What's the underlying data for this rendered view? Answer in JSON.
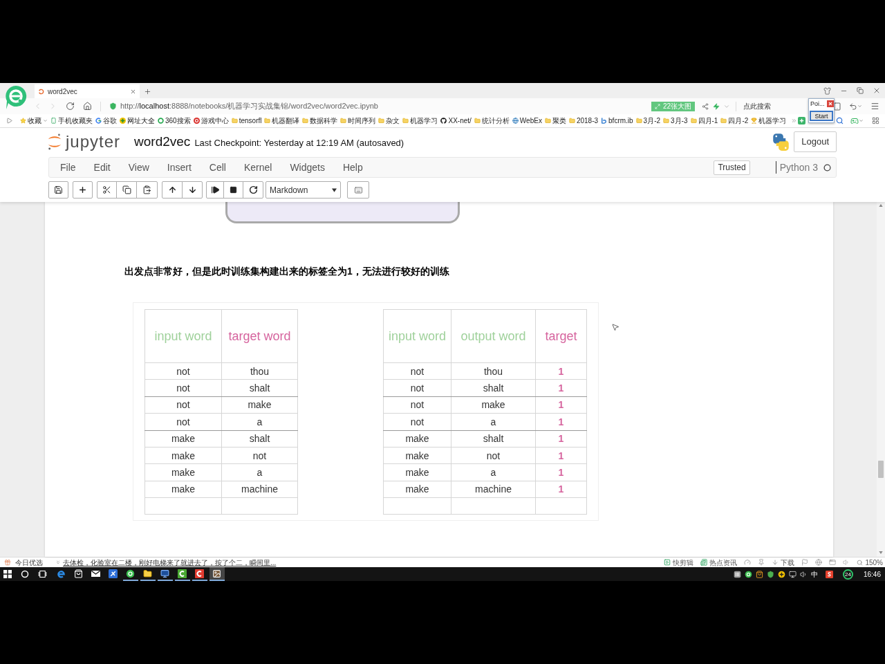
{
  "browser": {
    "tabs": [
      {
        "title": "word2vec",
        "selected": true
      }
    ],
    "address": {
      "scheme": "http://",
      "host": "localhost",
      "path": ":8888/notebooks/机器学习实战集锦/word2vec/word2vec.ipynb"
    },
    "image_badge": "22张大图",
    "search": {
      "placeholder": "点此搜索"
    },
    "popup": {
      "title": "Poi...",
      "button": "Start"
    },
    "bookmarks": [
      {
        "label": "收藏",
        "kind": "star"
      },
      {
        "label": "手机收藏夹",
        "kind": "phone"
      },
      {
        "label": "谷歌",
        "kind": "google"
      },
      {
        "label": "网址大全",
        "kind": "portal"
      },
      {
        "label": "360搜索",
        "kind": "ring"
      },
      {
        "label": "游戏中心",
        "kind": "game"
      },
      {
        "label": "tensorfl",
        "kind": "folder"
      },
      {
        "label": "机器翻译",
        "kind": "folder"
      },
      {
        "label": "数据科学",
        "kind": "folder"
      },
      {
        "label": "时间序列",
        "kind": "folder"
      },
      {
        "label": "杂文",
        "kind": "folder"
      },
      {
        "label": "机器学习",
        "kind": "folder"
      },
      {
        "label": "XX-net/",
        "kind": "github"
      },
      {
        "label": "统计分析",
        "kind": "folder"
      },
      {
        "label": "WebEx",
        "kind": "globe"
      },
      {
        "label": "聚类",
        "kind": "folder"
      },
      {
        "label": "2018-3",
        "kind": "folder"
      },
      {
        "label": "bfcrm.ib",
        "kind": "letter"
      },
      {
        "label": "3月-2",
        "kind": "folder"
      },
      {
        "label": "3月-3",
        "kind": "folder"
      },
      {
        "label": "四月-1",
        "kind": "folder"
      },
      {
        "label": "四月-2",
        "kind": "folder"
      },
      {
        "label": "机器学习",
        "kind": "trophy"
      }
    ]
  },
  "jupyter": {
    "logo_text": "jupyter",
    "notebook_name": "word2vec",
    "checkpoint": "Last Checkpoint: Yesterday at 12:19 AM (autosaved)",
    "logout": "Logout",
    "menu": [
      "File",
      "Edit",
      "View",
      "Insert",
      "Cell",
      "Kernel",
      "Widgets",
      "Help"
    ],
    "trusted": "Trusted",
    "kernel": {
      "name": "Python 3",
      "busy": false
    },
    "cell_type": "Markdown"
  },
  "notebook": {
    "note": "出发点非常好，但是此时训练集构建出来的标签全为1，无法进行较好的训练",
    "tables": [
      {
        "columns": [
          {
            "label": "input word",
            "color": "#9fd19b",
            "kind": "word"
          },
          {
            "label": "target word",
            "color": "#d6649e",
            "kind": "word"
          }
        ],
        "rows": [
          [
            "not",
            "thou"
          ],
          [
            "not",
            "shalt"
          ],
          [
            "not",
            "make"
          ],
          [
            "not",
            "a"
          ],
          [
            "make",
            "shalt"
          ],
          [
            "make",
            "not"
          ],
          [
            "make",
            "a"
          ],
          [
            "make",
            "machine"
          ]
        ]
      },
      {
        "columns": [
          {
            "label": "input word",
            "color": "#9fd19b",
            "kind": "word"
          },
          {
            "label": "output word",
            "color": "#9fd19b",
            "kind": "word"
          },
          {
            "label": "target",
            "color": "#d6649e",
            "kind": "label"
          }
        ],
        "rows": [
          [
            "not",
            "thou",
            "1"
          ],
          [
            "not",
            "shalt",
            "1"
          ],
          [
            "not",
            "make",
            "1"
          ],
          [
            "not",
            "a",
            "1"
          ],
          [
            "make",
            "shalt",
            "1"
          ],
          [
            "make",
            "not",
            "1"
          ],
          [
            "make",
            "a",
            "1"
          ],
          [
            "make",
            "machine",
            "1"
          ]
        ]
      }
    ]
  },
  "status_bar": {
    "feed_label": "今日优选",
    "headline": "去体检，化验室在二楼，刚好电梯来了就进去了，按了个二，瞬间里...",
    "tools": [
      {
        "kind": "clip",
        "label": "快剪辑"
      },
      {
        "kind": "news",
        "label": "热点资讯"
      },
      {
        "kind": "speed"
      },
      {
        "kind": "pin"
      },
      {
        "kind": "download",
        "label": "下载"
      },
      {
        "kind": "flag"
      },
      {
        "kind": "ie"
      },
      {
        "kind": "window"
      },
      {
        "kind": "volume"
      }
    ],
    "zoom": "150%"
  },
  "taskbar": {
    "apps": [
      {
        "kind": "edge",
        "running": false,
        "selected": false
      },
      {
        "kind": "store",
        "running": false,
        "selected": false
      },
      {
        "kind": "mail",
        "running": false,
        "selected": false
      },
      {
        "kind": "feather",
        "running": false,
        "selected": false
      },
      {
        "kind": "browser",
        "running": true,
        "selected": false
      },
      {
        "kind": "folder",
        "running": true,
        "selected": false
      },
      {
        "kind": "remote",
        "running": true,
        "selected": false
      },
      {
        "kind": "recorder",
        "running": true,
        "selected": false
      },
      {
        "kind": "editor",
        "running": true,
        "selected": false
      },
      {
        "kind": "painter",
        "running": true,
        "selected": true
      }
    ],
    "tray": {
      "ime": "中",
      "badge": "24",
      "clock": "16:46"
    }
  }
}
